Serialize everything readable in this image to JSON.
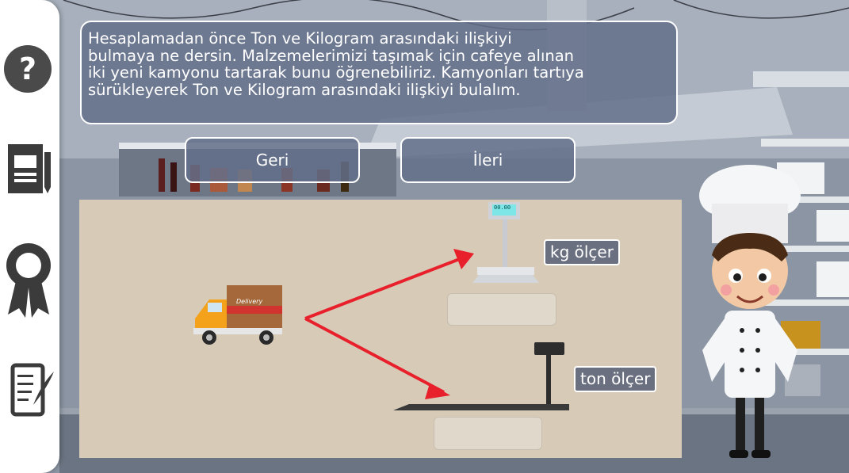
{
  "dialog": {
    "lines": [
      "Hesaplamadan önce Ton ve Kilogram arasındaki ilişkiyi",
      "bulmaya ne dersin. Malzemelerimizi taşımak için cafeye alınan",
      "iki yeni kamyonu tartarak bunu öğrenebiliriz. Kamyonları tartıya",
      "sürükleyerek Ton ve Kilogram arasındaki ilişkiyi bulalım."
    ]
  },
  "nav": {
    "back_label": "Geri",
    "next_label": "İleri"
  },
  "activity": {
    "truck_text": "Delivery",
    "kg_scale_label": "kg ölçer",
    "ton_scale_label": "ton ölçer",
    "kg_display": "00.00"
  },
  "sidebar": {
    "icons": [
      "help-icon",
      "notebook-icon",
      "achievement-badge-icon",
      "scroll-quill-icon"
    ]
  },
  "colors": {
    "accent_arrow": "#e8202c",
    "panel": "#636e8a",
    "board": "#d7cbb7"
  }
}
